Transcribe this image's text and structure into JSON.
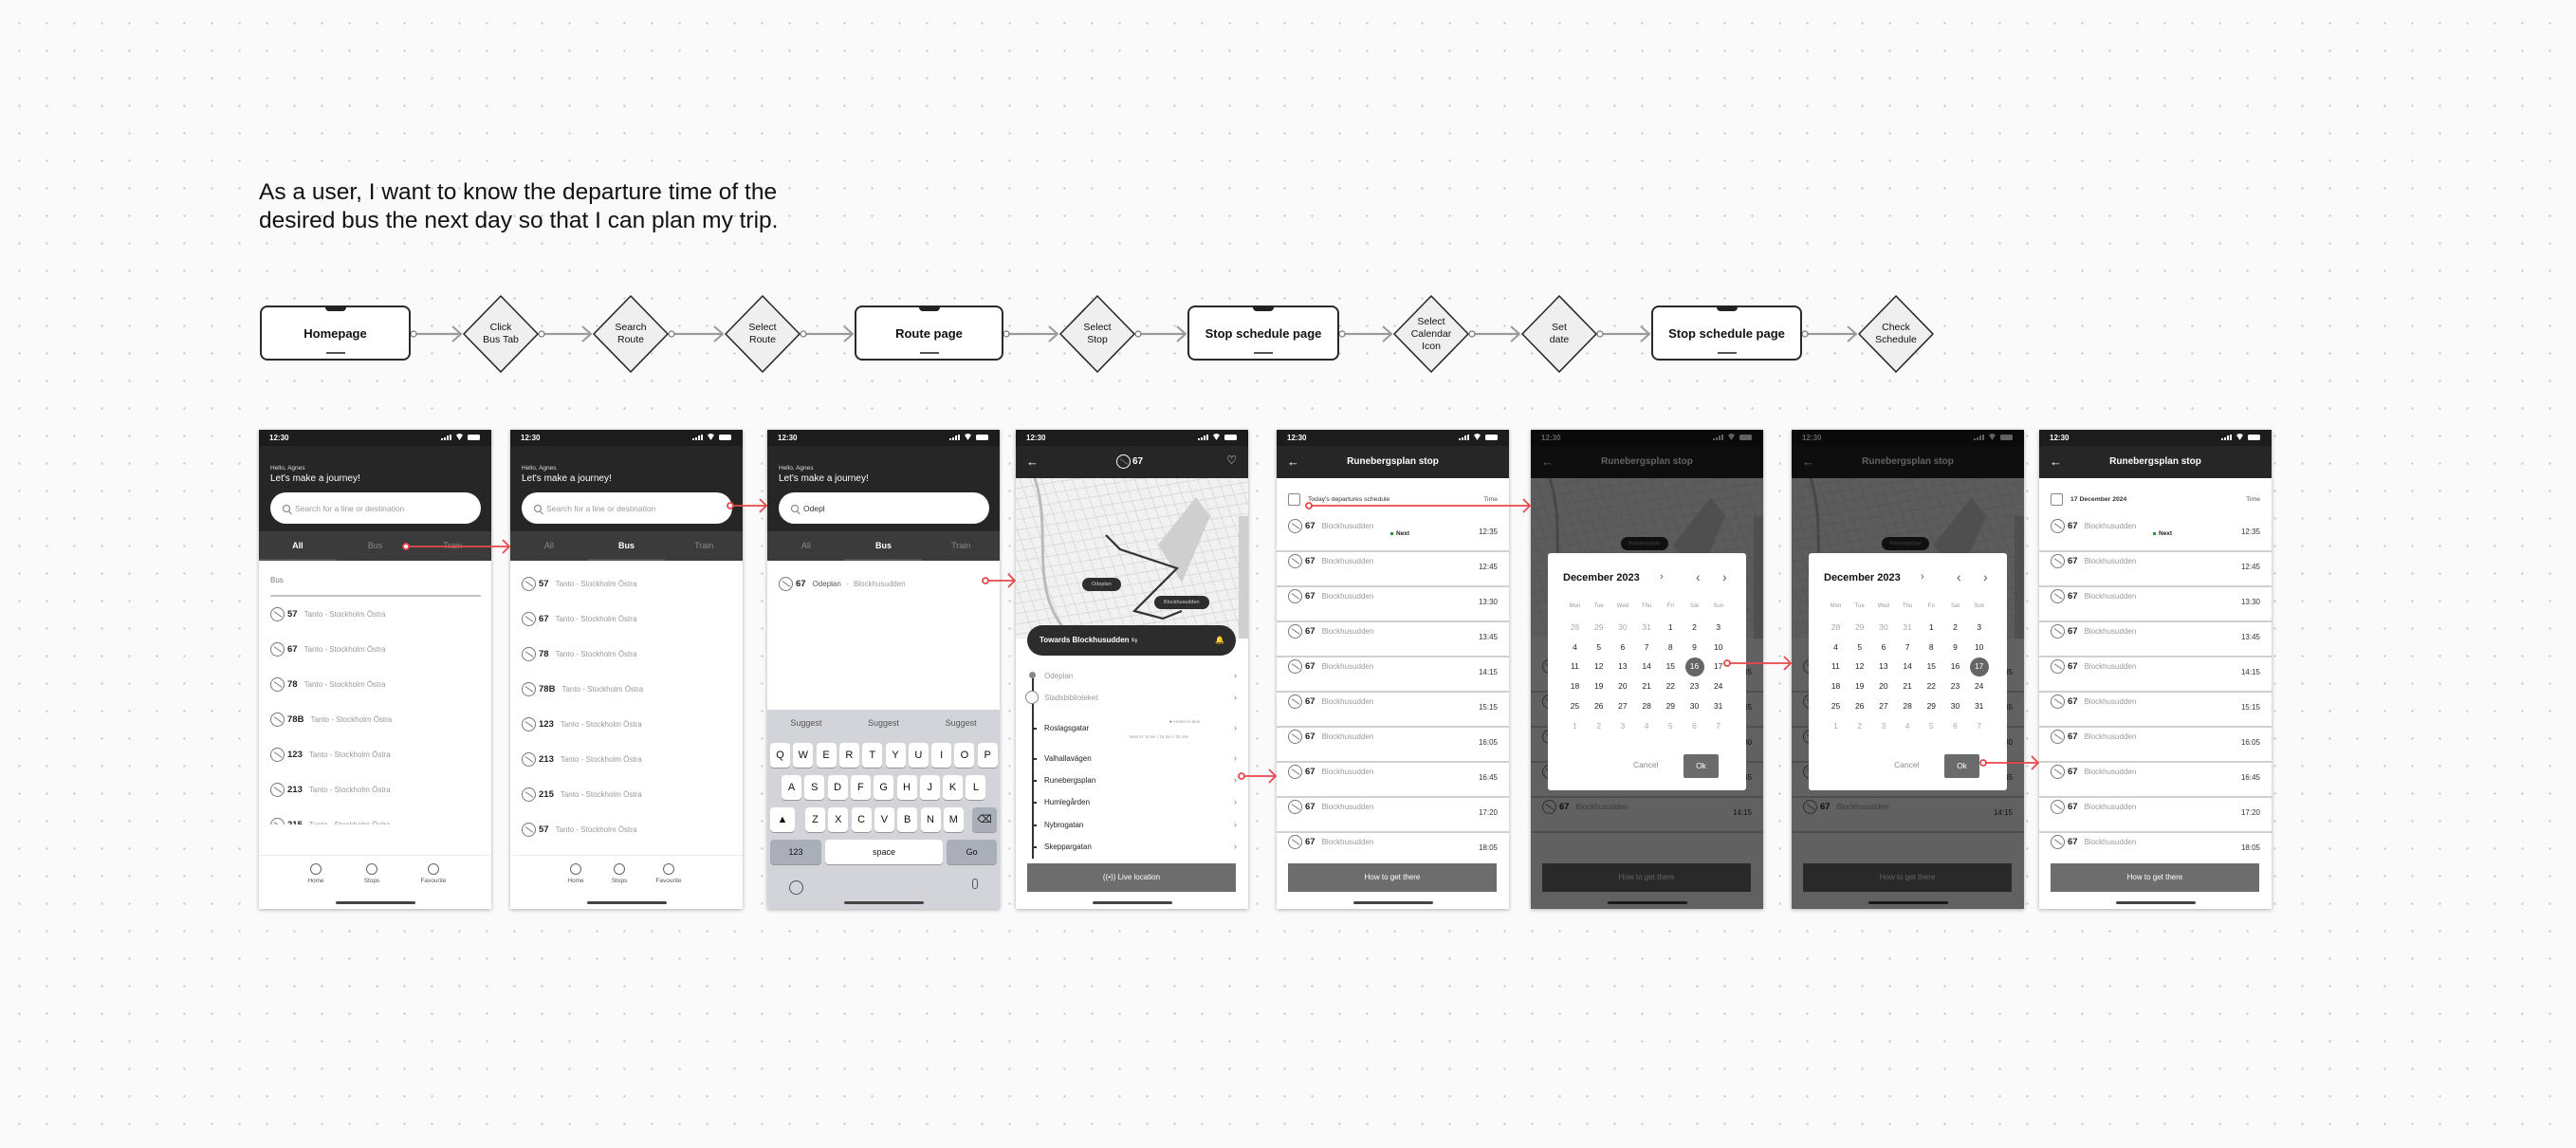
{
  "story": [
    "As a user, I want to know the departure time of the",
    "desired bus the next day so that I can plan my trip."
  ],
  "flow": [
    {
      "type": "screen",
      "label": "Homepage"
    },
    {
      "type": "action",
      "label": "Click\nBus Tab"
    },
    {
      "type": "action",
      "label": "Search\nRoute"
    },
    {
      "type": "action",
      "label": "Select\nRoute"
    },
    {
      "type": "screen",
      "label": "Route page"
    },
    {
      "type": "action",
      "label": "Select\nStop"
    },
    {
      "type": "screen",
      "label": "Stop schedule page"
    },
    {
      "type": "action",
      "label": "Select\nCalendar\nIcon"
    },
    {
      "type": "action",
      "label": "Set\ndate"
    },
    {
      "type": "screen",
      "label": "Stop schedule page"
    },
    {
      "type": "action",
      "label": "Check\nSchedule"
    }
  ],
  "colors": {
    "flow_arrow": "#9a9a9a",
    "interaction_arrow": "#e8474c",
    "header": "#262626",
    "next_dot": "#2a9d3a"
  },
  "status_time": "12:30",
  "home": {
    "greeting": "Hello, Agnes",
    "title": "Let's make a journey!",
    "search_placeholder": "Search for a line or destination",
    "tabs": [
      "All",
      "Bus",
      "Train"
    ],
    "section": "Bus",
    "nav": [
      "Home",
      "Stops",
      "Favourite"
    ],
    "all_lines": [
      {
        "num": "57",
        "route": "Tanto - Stockholm Östra"
      },
      {
        "num": "67",
        "route": "Tanto - Stockholm Östra"
      },
      {
        "num": "78",
        "route": "Tanto - Stockholm Östra"
      },
      {
        "num": "78B",
        "route": "Tanto - Stockholm Östra"
      },
      {
        "num": "123",
        "route": "Tanto - Stockholm Östra"
      },
      {
        "num": "213",
        "route": "Tanto - Stockholm Östra"
      },
      {
        "num": "215",
        "route": "Tanto - Stockholm Östra"
      }
    ],
    "bus_lines": [
      {
        "num": "57",
        "route": "Tanto - Stockholm Östra"
      },
      {
        "num": "67",
        "route": "Tanto - Stockholm Östra"
      },
      {
        "num": "78",
        "route": "Tanto - Stockholm Östra"
      },
      {
        "num": "78B",
        "route": "Tanto - Stockholm Östra"
      },
      {
        "num": "123",
        "route": "Tanto - Stockholm Östra"
      },
      {
        "num": "213",
        "route": "Tanto - Stockholm Östra"
      },
      {
        "num": "215",
        "route": "Tanto - Stockholm Östra"
      },
      {
        "num": "57",
        "route": "Tanto - Stockholm Östra"
      }
    ]
  },
  "search": {
    "query": "Odepl",
    "result": {
      "num": "67",
      "from": "Odeplan",
      "sep": " - ",
      "to": "Blockhusudden"
    },
    "suggestions": [
      "Suggest",
      "Suggest",
      "Suggest"
    ],
    "keys": [
      [
        "Q",
        "W",
        "E",
        "R",
        "T",
        "Y",
        "U",
        "I",
        "O",
        "P"
      ],
      [
        "A",
        "S",
        "D",
        "F",
        "G",
        "H",
        "J",
        "K",
        "L"
      ],
      [
        "Z",
        "X",
        "C",
        "V",
        "B",
        "N",
        "M"
      ]
    ],
    "num_key": "123",
    "space_key": "space",
    "go_key": "Go"
  },
  "route": {
    "line": "67",
    "map_labels": [
      "Odeplan",
      "Blockhusudden"
    ],
    "direction": "Towards Blockhusudden",
    "stops": [
      "Odeplan",
      "Stadsbiblioteket",
      "Roslagsgatar",
      "Valhallavägen",
      "Runebergsplan",
      "Humlegården",
      "Nybrogatan",
      "Skeppargatan"
    ],
    "arrival_status": "Arrives in time",
    "next_departures": "Next in: 5 min / 15 min / 25 min",
    "live_button": "Live location"
  },
  "schedule": {
    "title": "Runebergsplan stop",
    "header_today": "Today's departures schedule",
    "header_selected": "17 December 2024",
    "time_label": "Time",
    "line": "67",
    "destination": "Blockhusudden",
    "next_label": "Next",
    "times": [
      "12:35",
      "12:45",
      "13:30",
      "13:45",
      "14:15",
      "15:15",
      "16:05",
      "16:45",
      "17:20",
      "18:05"
    ],
    "cta": "How to get there",
    "map_label": "Runebergsplan"
  },
  "calendar": {
    "month": "December 2023",
    "weekdays": [
      "Mon",
      "Tue",
      "Wed",
      "Thu",
      "Fri",
      "Sat",
      "Sun"
    ],
    "days": [
      [
        "28",
        "29",
        "30",
        "31",
        "1",
        "2",
        "3"
      ],
      [
        "4",
        "5",
        "6",
        "7",
        "8",
        "9",
        "10"
      ],
      [
        "11",
        "12",
        "13",
        "14",
        "15",
        "16",
        "17"
      ],
      [
        "18",
        "19",
        "20",
        "21",
        "22",
        "23",
        "24"
      ],
      [
        "25",
        "26",
        "27",
        "28",
        "29",
        "30",
        "31"
      ],
      [
        "1",
        "2",
        "3",
        "4",
        "5",
        "6",
        "7"
      ]
    ],
    "selected_before": "16",
    "selected_after": "17",
    "cancel": "Cancel",
    "ok": "Ok"
  }
}
